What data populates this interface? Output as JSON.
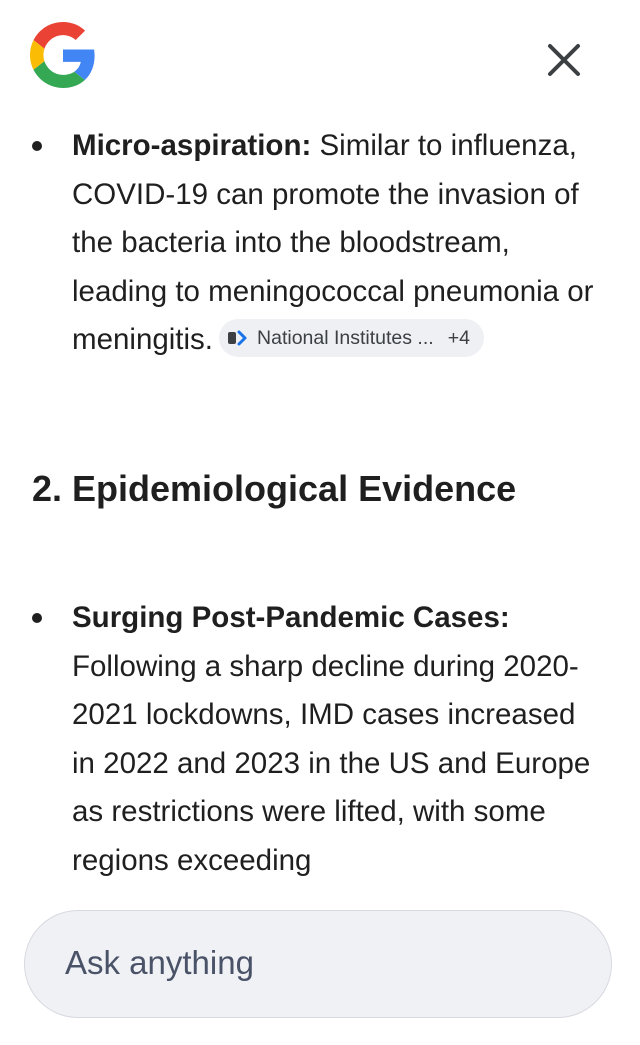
{
  "header": {
    "logo_icon": "google-g-logo",
    "close_icon": "close-icon"
  },
  "items": [
    {
      "bold": "Micro-aspiration:",
      "text": " Similar to influenza, COVID-19 can promote the invasion of the bacteria into the bloodstream, leading to meningococcal pneumonia or meningitis.",
      "citation": {
        "source": "National Institutes ...",
        "extra": "+4"
      }
    },
    {
      "bold": "Surging Post-Pandemic Cases:",
      "text": " Following a sharp decline during 2020-2021 lockdowns, IMD cases increased in 2022 and 2023 in the US and Europe as restrictions were lifted, with some regions exceeding"
    }
  ],
  "section_heading": "2. Epidemiological Evidence",
  "input": {
    "placeholder": "Ask anything"
  },
  "colors": {
    "chip_bg": "#eef0f4",
    "input_bg": "#eff1f5",
    "text": "#1f1f1f"
  }
}
